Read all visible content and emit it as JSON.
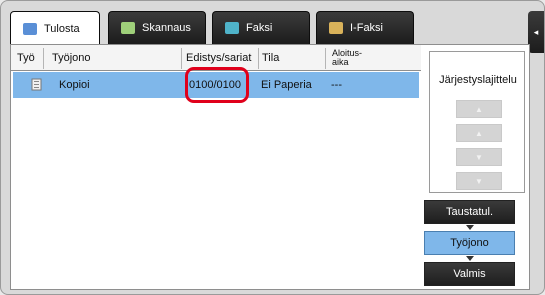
{
  "tabs": [
    {
      "label": "Tulosta",
      "icon": "print-icon",
      "active": true
    },
    {
      "label": "Skannaus",
      "icon": "scan-icon",
      "active": false
    },
    {
      "label": "Faksi",
      "icon": "fax-icon",
      "active": false
    },
    {
      "label": "I-Faksi",
      "icon": "internet-fax-icon",
      "active": false
    }
  ],
  "table": {
    "headers": {
      "job": "Työ",
      "queue": "Työjono",
      "progress": "Edistys/sariat",
      "status": "Tila",
      "start_line1": "Aloitus-",
      "start_line2": "aika"
    },
    "rows": [
      {
        "queue": "Kopioi",
        "progress": "0100/0100",
        "status": "Ei Paperia",
        "start": "---"
      }
    ]
  },
  "sort": {
    "title": "Järjestyslajittelu",
    "buttons": [
      "▲",
      "▲",
      "▼",
      "▼"
    ]
  },
  "filters": {
    "background": "Taustatul.",
    "queue": "Työjono",
    "done": "Valmis"
  },
  "side_tab_glyph": "◂",
  "colors": {
    "accent": "#7fb7ea",
    "highlight": "#e0001b",
    "tab_dark": "#1c1c1c"
  }
}
